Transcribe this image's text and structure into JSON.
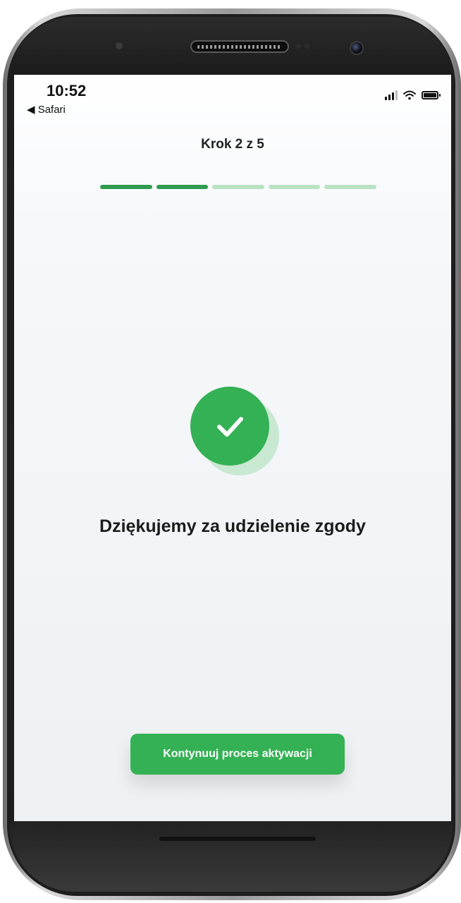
{
  "status_bar": {
    "time": "10:52",
    "back_label": "◀ Safari"
  },
  "step": {
    "title": "Krok 2 z 5",
    "current": 2,
    "total": 5
  },
  "confirmation": {
    "message": "Dziękujemy za udzielenie zgody"
  },
  "actions": {
    "continue_label": "Kontynuuj proces aktywacji"
  },
  "colors": {
    "accent": "#34b154",
    "progress_done": "#2e9b4f",
    "progress_pending": "#b9e2c5"
  }
}
